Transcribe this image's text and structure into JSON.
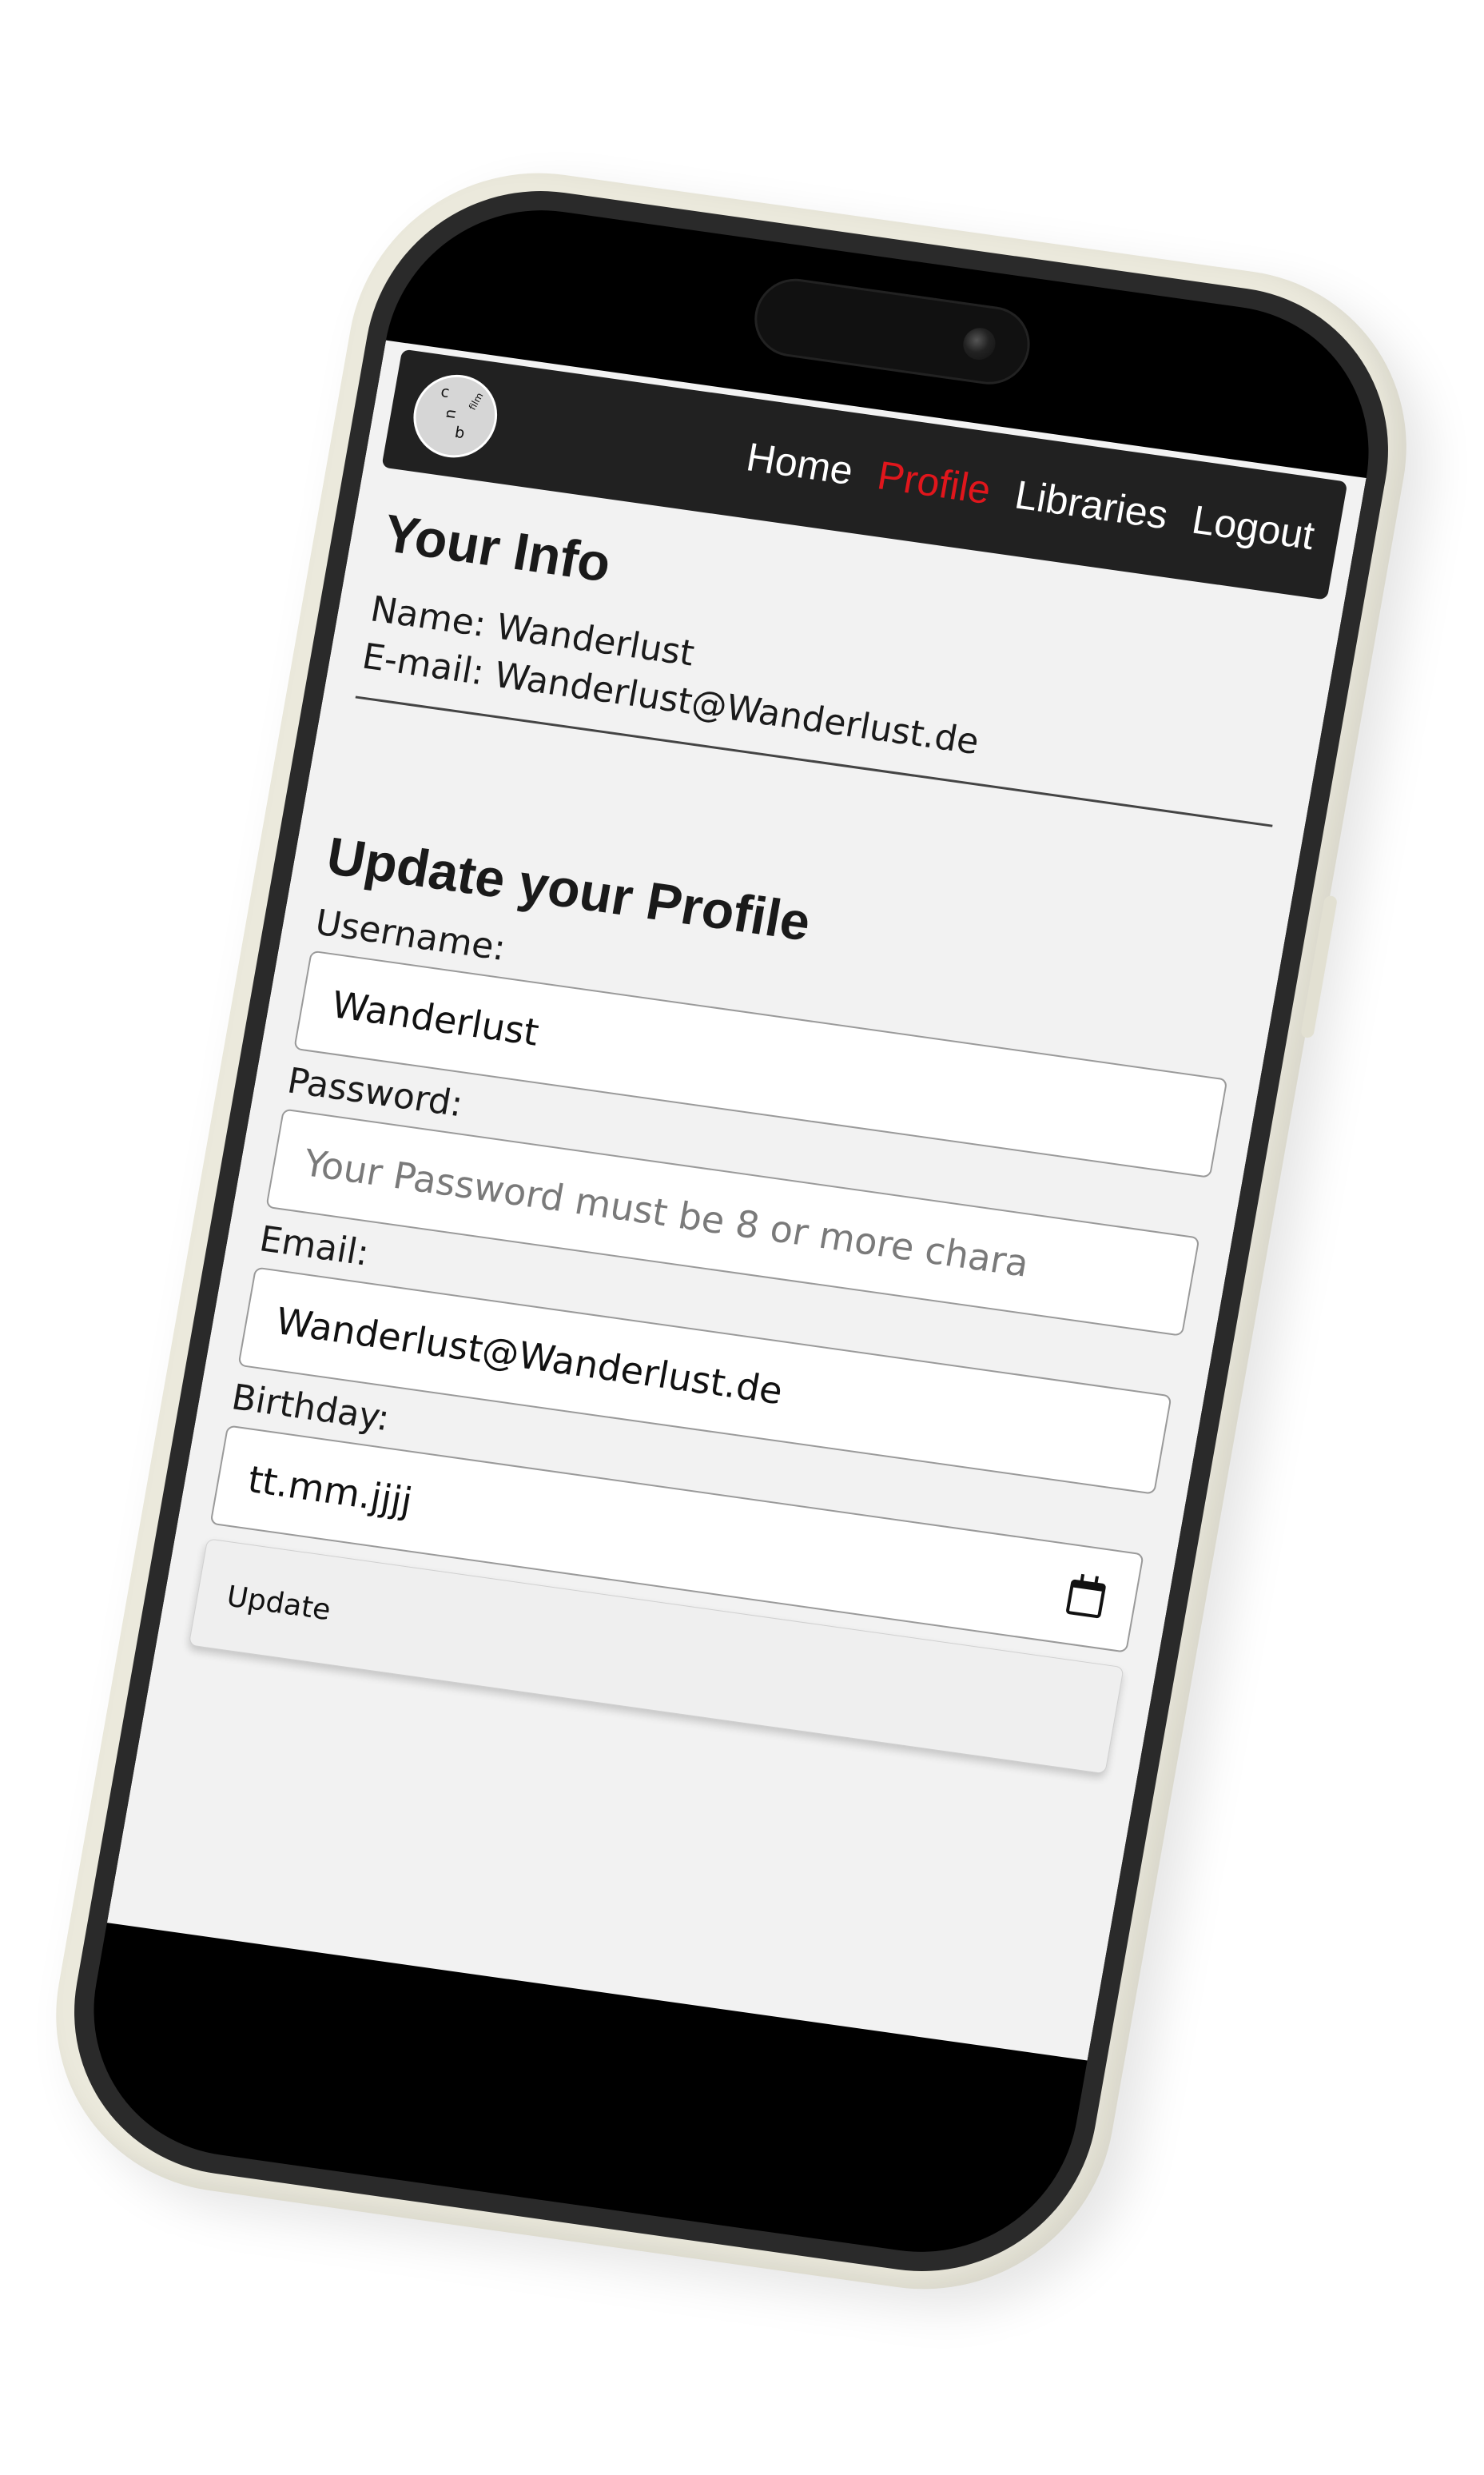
{
  "navbar": {
    "logo_letters": [
      "c",
      "u",
      "film",
      "b"
    ],
    "links": [
      {
        "label": "Home",
        "active": false
      },
      {
        "label": "Profile",
        "active": true
      },
      {
        "label": "Libraries",
        "active": false
      },
      {
        "label": "Logout",
        "active": false
      }
    ],
    "active_color": "#e0161c",
    "background_color": "#212121"
  },
  "info": {
    "heading": "Your Info",
    "name_line": "Name: Wanderlust",
    "email_line": "E-mail: Wanderlust@Wanderlust.de"
  },
  "update_form": {
    "heading": "Update your Profile",
    "username_label": "Username:",
    "username_value": "Wanderlust",
    "password_label": "Password:",
    "password_placeholder": "Your Password must be 8 or more chara",
    "email_label": "Email:",
    "email_value": "Wanderlust@Wanderlust.de",
    "birthday_label": "Birthday:",
    "birthday_placeholder": "tt.mm.jjjj",
    "birthday_icon": "calendar-icon",
    "submit_label": "Update"
  }
}
